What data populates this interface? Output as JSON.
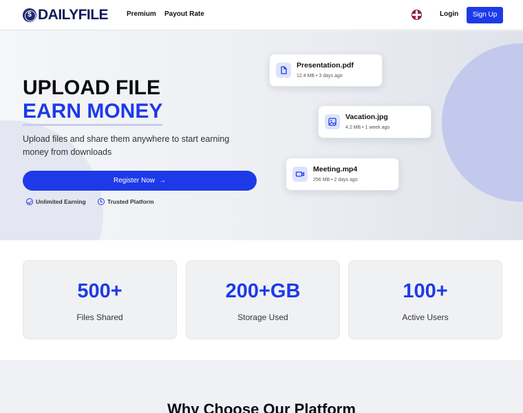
{
  "header": {
    "logo_text": "DAILYFILE",
    "logo_mark": "$",
    "nav": [
      "Premium",
      "Payout Rate"
    ],
    "login": "Login",
    "signup": "Sign Up",
    "language_icon": "uk-flag-icon"
  },
  "hero": {
    "title_line1": "UPLOAD FILE",
    "title_line2": "EARN MONEY",
    "description": "Upload files and share them anywhere to start earning money from downloads",
    "cta": "Register Now",
    "cta_arrow": "→",
    "badges": [
      "Unlimited Earning",
      "Trusted Platform"
    ]
  },
  "files": [
    {
      "name": "Presentation.pdf",
      "meta": "12.4 MB • 3 days ago",
      "icon": "document-icon"
    },
    {
      "name": "Vacation.jpg",
      "meta": "4.2 MB • 1 week ago",
      "icon": "image-icon"
    },
    {
      "name": "Meeting.mp4",
      "meta": "256 MB • 2 days ago",
      "icon": "video-icon"
    }
  ],
  "stats": [
    {
      "value": "500+",
      "label": "Files Shared"
    },
    {
      "value": "200+GB",
      "label": "Storage Used"
    },
    {
      "value": "100+",
      "label": "Active Users"
    }
  ],
  "section_title": "Why Choose Our Platform",
  "colors": {
    "accent": "#1d3ae8",
    "brand_dark": "#0f1a5c"
  }
}
